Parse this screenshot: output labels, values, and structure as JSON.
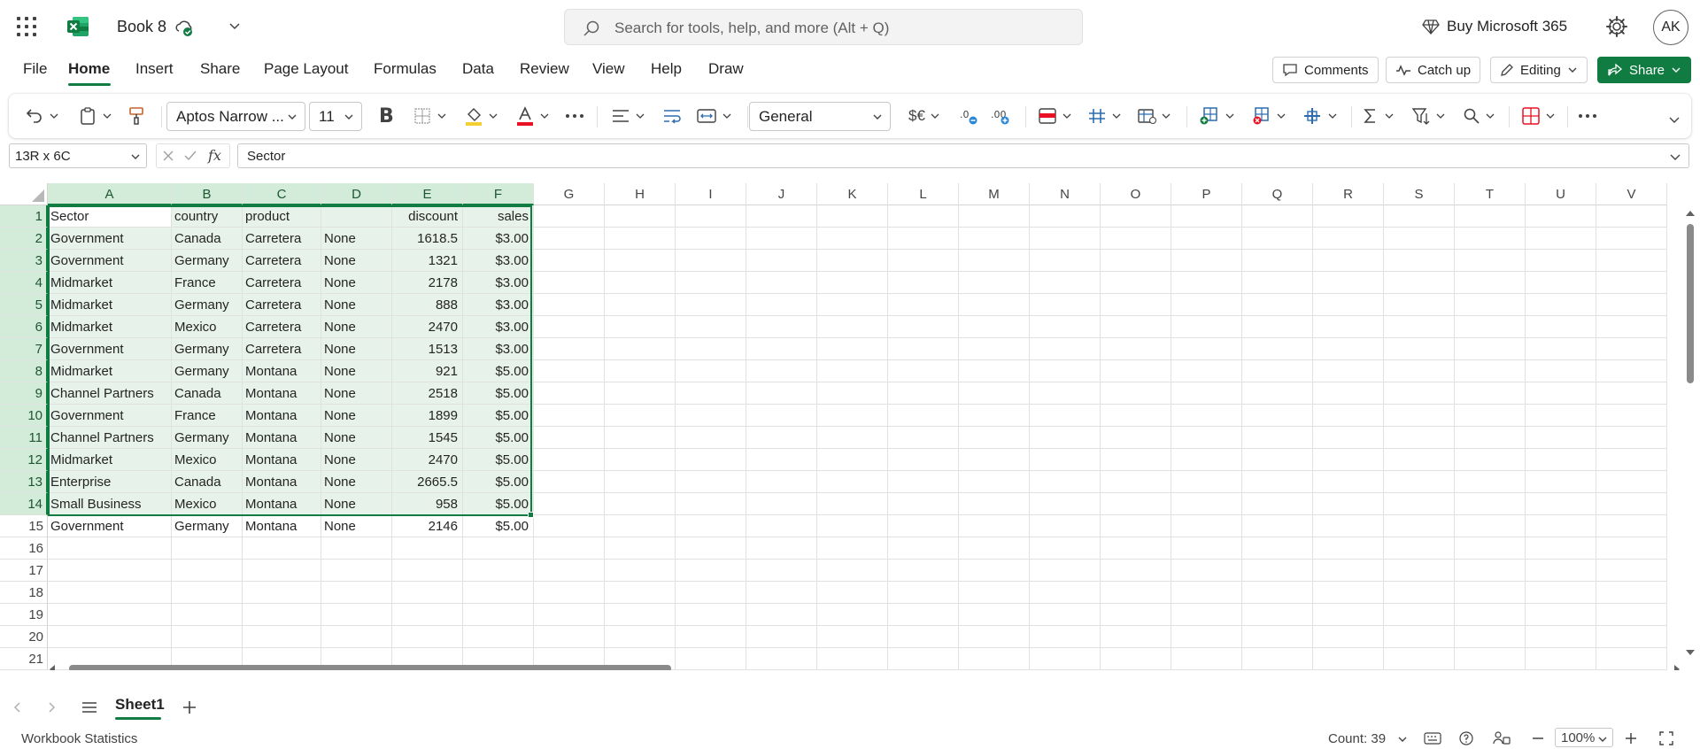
{
  "app": {
    "doc_title": "Book 8",
    "search_placeholder": "Search for tools, help, and more (Alt + Q)",
    "buy_label": "Buy Microsoft 365",
    "avatar_initials": "AK",
    "brand_color": "#107c41"
  },
  "menu": {
    "tabs": [
      "File",
      "Home",
      "Insert",
      "Share",
      "Page Layout",
      "Formulas",
      "Data",
      "Review",
      "View",
      "Help",
      "Draw"
    ],
    "active_tab": "Home",
    "comments_label": "Comments",
    "catchup_label": "Catch up",
    "editing_label": "Editing",
    "share_label": "Share"
  },
  "ribbon": {
    "font_name": "Aptos Narrow ...",
    "font_size": "11",
    "number_format": "General",
    "currency_symbol": "$€"
  },
  "formula_bar": {
    "name_box": "13R x 6C",
    "fx_symbol": "fx",
    "content": "Sector"
  },
  "grid": {
    "columns": [
      "A",
      "B",
      "C",
      "D",
      "E",
      "F",
      "G",
      "H",
      "I",
      "J",
      "K",
      "L",
      "M",
      "N",
      "O",
      "P",
      "Q",
      "R",
      "S",
      "T",
      "U",
      "V"
    ],
    "row_numbers": [
      "1",
      "2",
      "3",
      "4",
      "5",
      "6",
      "7",
      "8",
      "9",
      "10",
      "11",
      "12",
      "13",
      "14",
      "15",
      "16",
      "17",
      "18",
      "19",
      "20",
      "21"
    ],
    "rows": [
      [
        "Sector",
        "country",
        "product",
        "",
        "discount",
        "sales"
      ],
      [
        "Government",
        "Canada",
        "Carretera",
        "None",
        "1618.5",
        "$3.00"
      ],
      [
        "Government",
        "Germany",
        "Carretera",
        "None",
        "1321",
        "$3.00"
      ],
      [
        "Midmarket",
        "France",
        "Carretera",
        "None",
        "2178",
        "$3.00"
      ],
      [
        "Midmarket",
        "Germany",
        "Carretera",
        "None",
        "888",
        "$3.00"
      ],
      [
        "Midmarket",
        "Mexico",
        "Carretera",
        "None",
        "2470",
        "$3.00"
      ],
      [
        "Government",
        "Germany",
        "Carretera",
        "None",
        "1513",
        "$3.00"
      ],
      [
        "Midmarket",
        "Germany",
        "Montana",
        "None",
        "921",
        "$5.00"
      ],
      [
        "Channel Partners",
        "Canada",
        "Montana",
        "None",
        "2518",
        "$5.00"
      ],
      [
        "Government",
        "France",
        "Montana",
        "None",
        "1899",
        "$5.00"
      ],
      [
        "Channel Partners",
        "Germany",
        "Montana",
        "None",
        "1545",
        "$5.00"
      ],
      [
        "Midmarket",
        "Mexico",
        "Montana",
        "None",
        "2470",
        "$5.00"
      ],
      [
        "Enterprise",
        "Canada",
        "Montana",
        "None",
        "2665.5",
        "$5.00"
      ],
      [
        "Small Business",
        "Mexico",
        "Montana",
        "None",
        "958",
        "$5.00"
      ],
      [
        "Government",
        "Germany",
        "Montana",
        "None",
        "2146",
        "$5.00"
      ]
    ]
  },
  "sheets": {
    "active": "Sheet1"
  },
  "status": {
    "workbook_stats": "Workbook Statistics",
    "count": "Count: 39",
    "zoom": "100%"
  }
}
